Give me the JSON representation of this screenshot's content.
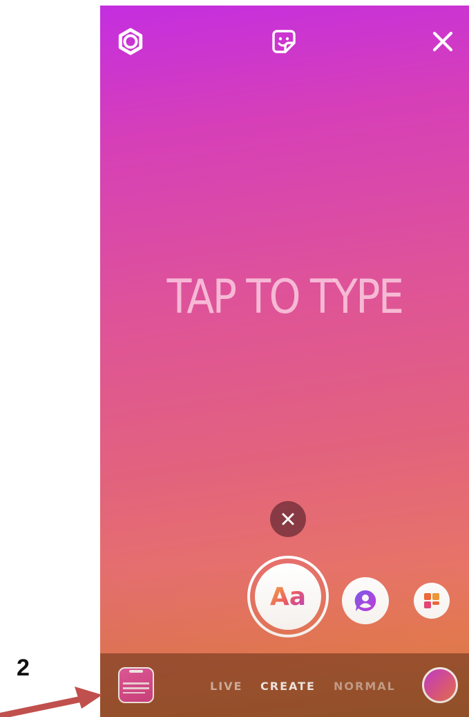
{
  "header": {
    "settings_icon": "settings-icon",
    "sticker_icon": "sticker-icon",
    "close_icon": "close-icon"
  },
  "canvas": {
    "prompt": "TAP TO TYPE"
  },
  "controls": {
    "dismiss_icon": "close-icon",
    "text_button_label": "Aa",
    "mention_icon": "mention-icon",
    "templates_icon": "templates-icon"
  },
  "bottom_bar": {
    "modes": [
      "LIVE",
      "CREATE",
      "NORMAL"
    ],
    "active_mode": "CREATE",
    "gallery_icon": "gallery-thumbnail"
  },
  "annotation": {
    "step_number": "2"
  },
  "colors": {
    "gradient_top": "#c42ee0",
    "gradient_bottom": "#ec7e55",
    "annotation_arrow": "#c0504d"
  }
}
